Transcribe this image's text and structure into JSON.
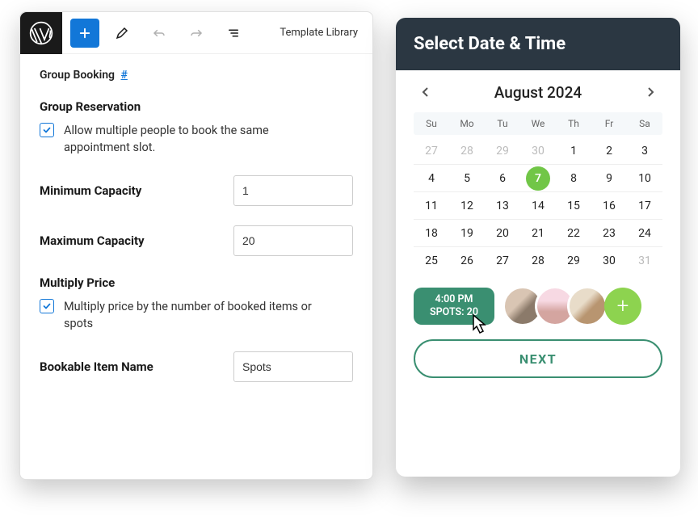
{
  "toolbar": {
    "template_library": "Template Library"
  },
  "breadcrumb": {
    "label": "Group Booking",
    "hash": "#"
  },
  "group_reservation": {
    "heading": "Group Reservation",
    "checkbox_label": "Allow multiple people to book the same appointment slot."
  },
  "min_capacity": {
    "label": "Minimum Capacity",
    "value": "1"
  },
  "max_capacity": {
    "label": "Maximum Capacity",
    "value": "20"
  },
  "multiply_price": {
    "heading": "Multiply Price",
    "checkbox_label": "Multiply price by the number of booked items or spots"
  },
  "bookable_item": {
    "label": "Bookable Item Name",
    "value": "Spots"
  },
  "calendar": {
    "title": "Select Date & Time",
    "month": "August 2024",
    "dow": [
      "Su",
      "Mo",
      "Tu",
      "We",
      "Th",
      "Fr",
      "Sa"
    ],
    "selected_day": 7,
    "weeks": [
      [
        {
          "n": 27,
          "o": true
        },
        {
          "n": 28,
          "o": true
        },
        {
          "n": 29,
          "o": true
        },
        {
          "n": 30,
          "o": true
        },
        {
          "n": 1
        },
        {
          "n": 2
        },
        {
          "n": 3
        }
      ],
      [
        {
          "n": 4
        },
        {
          "n": 5
        },
        {
          "n": 6
        },
        {
          "n": 7,
          "sel": true
        },
        {
          "n": 8
        },
        {
          "n": 9
        },
        {
          "n": 10
        }
      ],
      [
        {
          "n": 11
        },
        {
          "n": 12
        },
        {
          "n": 13
        },
        {
          "n": 14
        },
        {
          "n": 15
        },
        {
          "n": 16
        },
        {
          "n": 17
        }
      ],
      [
        {
          "n": 18
        },
        {
          "n": 19
        },
        {
          "n": 20
        },
        {
          "n": 21
        },
        {
          "n": 22
        },
        {
          "n": 23
        },
        {
          "n": 24
        }
      ],
      [
        {
          "n": 25
        },
        {
          "n": 26
        },
        {
          "n": 27
        },
        {
          "n": 28
        },
        {
          "n": 29
        },
        {
          "n": 30
        },
        {
          "n": 31,
          "o": true
        }
      ]
    ]
  },
  "slot": {
    "time": "4:00 PM",
    "spots": "SPOTS: 20"
  },
  "next_label": "NEXT"
}
